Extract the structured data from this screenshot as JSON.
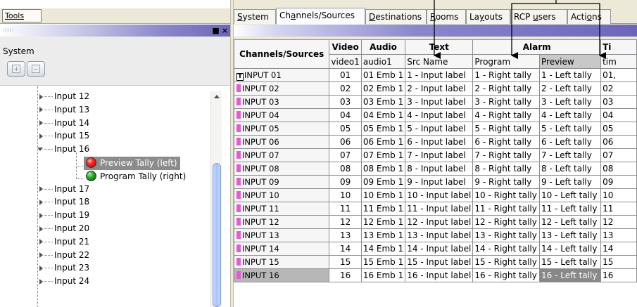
{
  "left": {
    "tools_label": "Tools",
    "panel_controls": {
      "restore": "■",
      "close": "×"
    },
    "system_label": "System",
    "tree": {
      "inputs_before": [
        "Input 12",
        "Input 13",
        "Input 14",
        "Input 15"
      ],
      "expanded_input": "Input 16",
      "tally_items": [
        {
          "label": "Preview Tally (left)",
          "color": "#e02020",
          "selected": true
        },
        {
          "label": "Program Tally (right)",
          "color": "#1a8c1a",
          "selected": false
        }
      ],
      "inputs_after": [
        "Input 17",
        "Input 18",
        "Input 19",
        "Input 20",
        "Input 21",
        "Input 22",
        "Input 23",
        "Input 24"
      ]
    }
  },
  "right": {
    "tabs": [
      {
        "u": "S",
        "rest": "ystem"
      },
      {
        "pre": "Ch",
        "u": "a",
        "rest": "nnels/Sources",
        "active": true
      },
      {
        "u": "D",
        "rest": "estinations"
      },
      {
        "u": "R",
        "rest": "ooms"
      },
      {
        "pre": "La",
        "u": "y",
        "rest": "outs"
      },
      {
        "pre": "RCP ",
        "u": "u",
        "rest": "sers"
      },
      {
        "pre": "Acti",
        "u": "o",
        "rest": "ns"
      }
    ],
    "grid": {
      "corner": "Channels/Sources",
      "groups": [
        "Video",
        "Audio",
        "Text",
        "Alarm",
        "Ti"
      ],
      "subheaders": [
        "video1",
        "audio1",
        "Src Name",
        "Program",
        "Preview",
        "tim"
      ],
      "rows": [
        {
          "name": "INPUT 01",
          "video": "01",
          "audio": "01  Emb 1",
          "text": "1 - Input label",
          "program": "1 - Right tally",
          "preview": "1 - Left tally",
          "time": "01,"
        },
        {
          "name": "INPUT 02",
          "video": "02",
          "audio": "02  Emb 1",
          "text": "2 - Input label",
          "program": "2 - Right tally",
          "preview": "2 - Left tally",
          "time": "02"
        },
        {
          "name": "INPUT 03",
          "video": "03",
          "audio": "03  Emb 1",
          "text": "3 - Input label",
          "program": "3 - Right tally",
          "preview": "3 - Left tally",
          "time": "03"
        },
        {
          "name": "INPUT 04",
          "video": "04",
          "audio": "04  Emb 1",
          "text": "4 - Input label",
          "program": "4 - Right tally",
          "preview": "4 - Left tally",
          "time": "04"
        },
        {
          "name": "INPUT 05",
          "video": "05",
          "audio": "05  Emb 1",
          "text": "5 - Input label",
          "program": "5 - Right tally",
          "preview": "5 - Left tally",
          "time": "05"
        },
        {
          "name": "INPUT 06",
          "video": "06",
          "audio": "06  Emb 1",
          "text": "6 - Input label",
          "program": "6 - Right tally",
          "preview": "6 - Left tally",
          "time": "06"
        },
        {
          "name": "INPUT 07",
          "video": "07",
          "audio": "07  Emb 1",
          "text": "7 - Input label",
          "program": "7 - Right tally",
          "preview": "7 - Left tally",
          "time": "07"
        },
        {
          "name": "INPUT 08",
          "video": "08",
          "audio": "08  Emb 1",
          "text": "8 - Input label",
          "program": "8 - Right tally",
          "preview": "8 - Left tally",
          "time": "08"
        },
        {
          "name": "INPUT 09",
          "video": "09",
          "audio": "09  Emb 1",
          "text": "9 - Input label",
          "program": "9 - Right tally",
          "preview": "9 - Left tally",
          "time": "09"
        },
        {
          "name": "INPUT 10",
          "video": "10",
          "audio": "10  Emb 1",
          "text": "10 - Input label",
          "program": "10 - Right tally",
          "preview": "10 - Left tally",
          "time": "10"
        },
        {
          "name": "INPUT 11",
          "video": "11",
          "audio": "11  Emb 1",
          "text": "11 - Input label",
          "program": "11 - Right tally",
          "preview": "11 - Left tally",
          "time": "11"
        },
        {
          "name": "INPUT 12",
          "video": "12",
          "audio": "12  Emb 1",
          "text": "12 - Input label",
          "program": "12 - Right tally",
          "preview": "12 - Left tally",
          "time": "12"
        },
        {
          "name": "INPUT 13",
          "video": "13",
          "audio": "13  Emb 1",
          "text": "13 - Input label",
          "program": "13 - Right tally",
          "preview": "13 - Left tally",
          "time": "13"
        },
        {
          "name": "INPUT 14",
          "video": "14",
          "audio": "14  Emb 1",
          "text": "14 - Input label",
          "program": "14 - Right tally",
          "preview": "14 - Left tally",
          "time": "14"
        },
        {
          "name": "INPUT 15",
          "video": "15",
          "audio": "15  Emb 1",
          "text": "15 - Input label",
          "program": "15 - Right tally",
          "preview": "15 - Left tally",
          "time": "15"
        },
        {
          "name": "INPUT 16",
          "video": "16",
          "audio": "16  Emb 1",
          "text": "16 - Input label",
          "program": "16 - Right tally",
          "preview": "16 - Left tally",
          "time": "16",
          "selected": true
        }
      ]
    }
  },
  "colors": {
    "source_swatch": "#e75ad3",
    "selection_gray": "#888888",
    "panel_title_purple": "#6c66b8"
  }
}
